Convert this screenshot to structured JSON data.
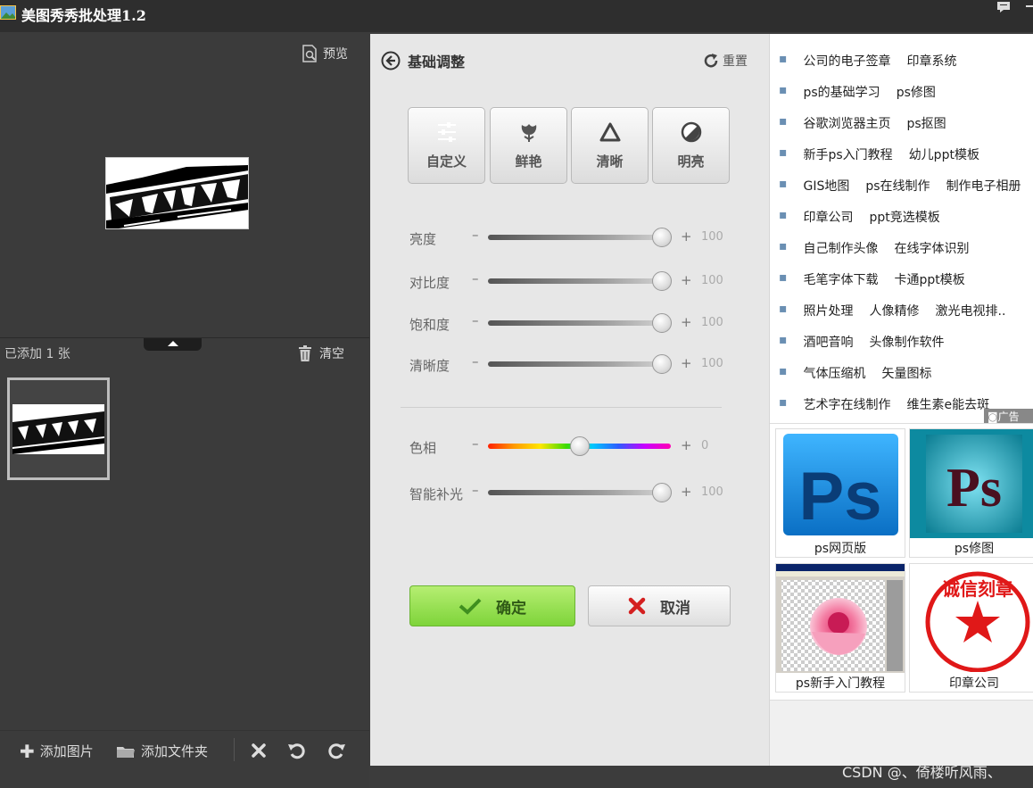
{
  "app": {
    "title": "美图秀秀批处理1.2"
  },
  "left": {
    "preview_label": "预览",
    "added_count": "已添加 1 张",
    "clear_label": "清空",
    "add_image_label": "添加图片",
    "add_folder_label": "添加文件夹"
  },
  "center": {
    "heading": "基础调整",
    "reset_label": "重置",
    "modes": [
      {
        "label": "自定义",
        "icon": "sliders-icon",
        "active": true
      },
      {
        "label": "鲜艳",
        "icon": "flower-icon",
        "active": false
      },
      {
        "label": "清晰",
        "icon": "triangle-icon",
        "active": false
      },
      {
        "label": "明亮",
        "icon": "contrast-icon",
        "active": false
      }
    ],
    "sliders": [
      {
        "label": "亮度",
        "minus": "–",
        "plus": "+",
        "value": "100",
        "level": 0.95
      },
      {
        "label": "对比度",
        "minus": "–",
        "plus": "+",
        "value": "100",
        "level": 0.95
      },
      {
        "label": "饱和度",
        "minus": "–",
        "plus": "+",
        "value": "100",
        "level": 0.95
      },
      {
        "label": "清晰度",
        "minus": "–",
        "plus": "+",
        "value": "100",
        "level": 0.95
      },
      {
        "label": "色相",
        "minus": "–",
        "plus": "+",
        "value": "0",
        "level": 0.5
      },
      {
        "label": "智能补光",
        "minus": "–",
        "plus": "+",
        "value": "100",
        "level": 0.95
      }
    ],
    "ok_label": "确定",
    "cancel_label": "取消"
  },
  "right": {
    "link_rows": [
      [
        "公司的电子签章",
        "印章系统"
      ],
      [
        "ps的基础学习",
        "ps修图"
      ],
      [
        "谷歌浏览器主页",
        "ps抠图"
      ],
      [
        "新手ps入门教程",
        "幼儿ppt模板"
      ],
      [
        "GIS地图",
        "ps在线制作",
        "制作电子相册"
      ],
      [
        "印章公司",
        "ppt竞选模板"
      ],
      [
        "自己制作头像",
        "在线字体识别"
      ],
      [
        "毛笔字体下载",
        "卡通ppt模板"
      ],
      [
        "照片处理",
        "人像精修",
        "激光电视排.."
      ],
      [
        "酒吧音响",
        "头像制作软件"
      ],
      [
        "气体压缩机",
        "矢量图标"
      ],
      [
        "艺术字在线制作",
        "维生素e能去斑"
      ]
    ],
    "ad_tag": "广告",
    "tiles": [
      {
        "caption": "ps网页版",
        "logo_text": "Ps"
      },
      {
        "caption": "ps修图",
        "logo_text": "Ps"
      },
      {
        "caption": "ps新手入门教程"
      },
      {
        "caption": "印章公司",
        "seal_text": "诚信刻章"
      }
    ]
  },
  "watermark": "CSDN @、倚楼听风雨、",
  "colors": {
    "accent_green": "#7ed43a",
    "ps_blue": "#1b8fe0",
    "link_dot": "#6a8fb3"
  }
}
